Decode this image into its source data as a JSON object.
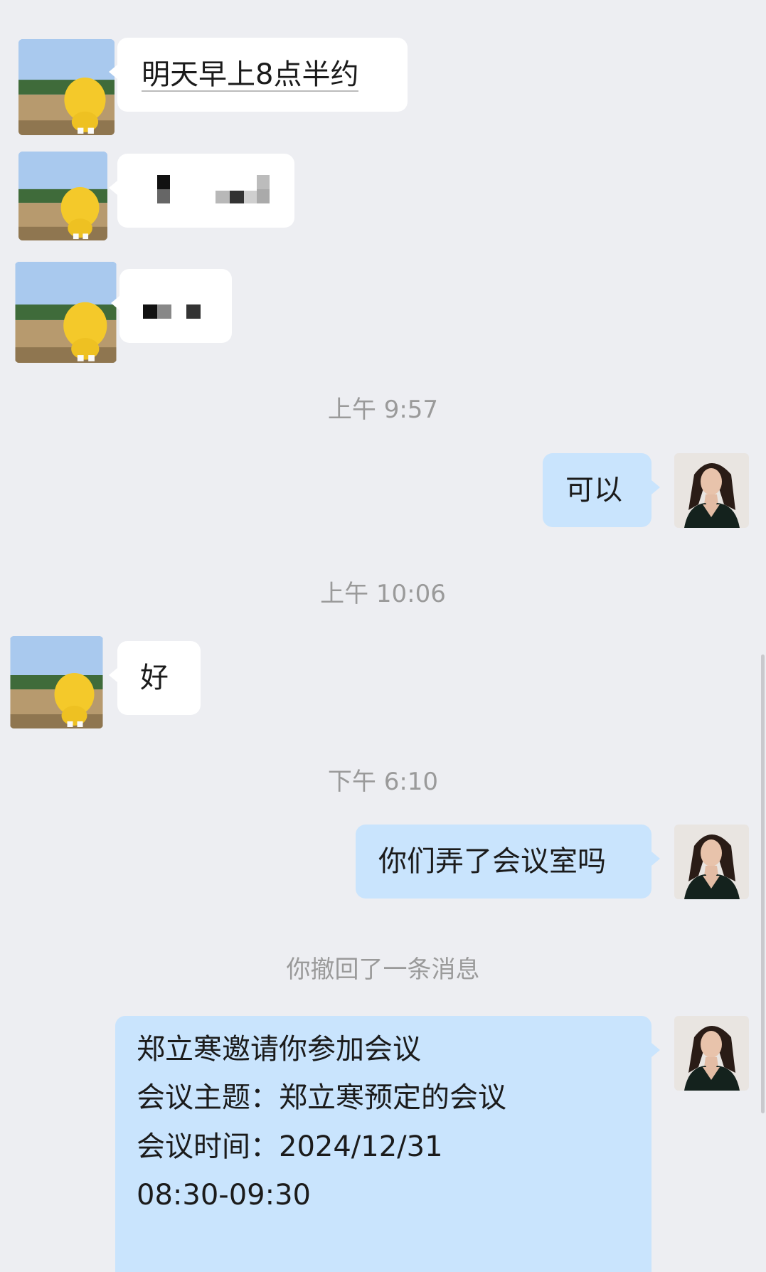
{
  "timestamps": {
    "t1": "上午 9:57",
    "t2": "上午 10:06",
    "t3": "下午 6:10"
  },
  "messages": {
    "m1": "明天早上8点半约",
    "m4": "可以",
    "m5": "好",
    "m6": "你们弄了会议室吗"
  },
  "system": {
    "recall": "你撤回了一条消息"
  },
  "invite": {
    "line1": "郑立寒邀请你参加会议",
    "line2": "会议主题：郑立寒预定的会议",
    "line3": "会议时间：2024/12/31",
    "line4": "08:30-09:30"
  },
  "icons": {
    "contact_avatar": "yellow-mascot-avatar",
    "self_avatar": "woman-portrait-avatar"
  },
  "colors": {
    "background": "#edeef2",
    "incoming_bubble": "#ffffff",
    "outgoing_bubble": "#c9e4fd"
  }
}
